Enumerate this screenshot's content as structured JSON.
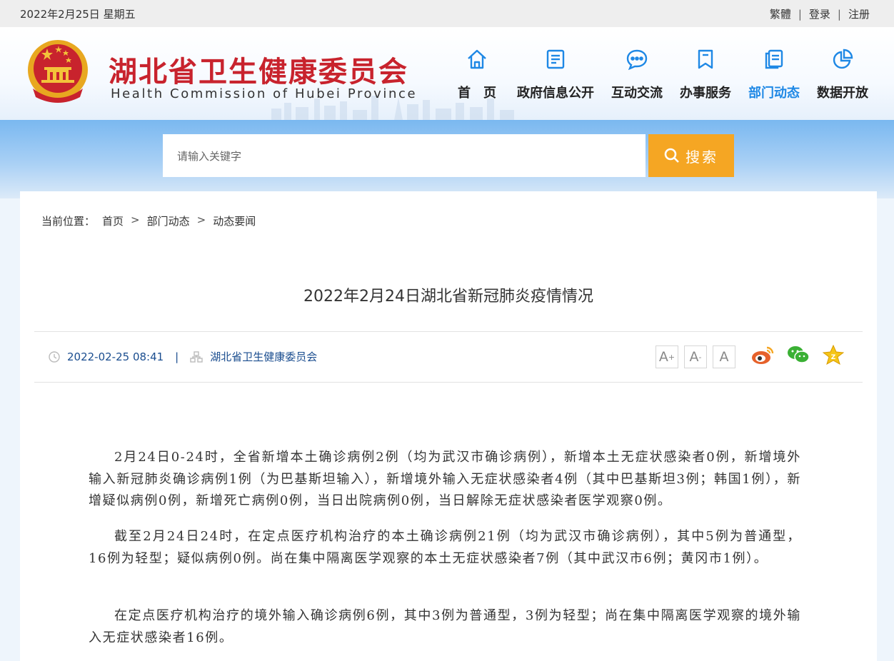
{
  "topbar": {
    "date": "2022年2月25日 星期五",
    "traditional": "繁體",
    "login": "登录",
    "register": "注册",
    "sep": "|"
  },
  "header": {
    "title": "湖北省卫生健康委员会",
    "subtitle": "Health Commission of Hubei Province"
  },
  "nav": [
    {
      "label": "首　页",
      "icon": "home-icon"
    },
    {
      "label": "政府信息公开",
      "icon": "document-icon"
    },
    {
      "label": "互动交流",
      "icon": "chat-bubble-icon"
    },
    {
      "label": "办事服务",
      "icon": "bookmark-icon"
    },
    {
      "label": "部门动态",
      "icon": "pages-icon",
      "active": true
    },
    {
      "label": "数据开放",
      "icon": "pie-chart-icon"
    }
  ],
  "search": {
    "placeholder": "请输入关键字",
    "button": "搜索"
  },
  "breadcrumb": {
    "prefix": "当前位置：",
    "items": [
      "首页",
      "部门动态",
      "动态要闻"
    ],
    "sep": ">"
  },
  "article": {
    "title": "2022年2月24日湖北省新冠肺炎疫情情况",
    "datetime": "2022-02-25 08:41",
    "meta_sep": "|",
    "source": "湖北省卫生健康委员会",
    "font_tools": [
      "A+",
      "A-",
      "A"
    ],
    "paragraphs": [
      "2月24日0-24时，全省新增本土确诊病例2例（均为武汉市确诊病例），新增本土无症状感染者0例，新增境外输入新冠肺炎确诊病例1例（为巴基斯坦输入），新增境外输入无症状感染者4例（其中巴基斯坦3例；韩国1例），新增疑似病例0例，新增死亡病例0例，当日出院病例0例，当日解除无症状感染者医学观察0例。",
      "截至2月24日24时，在定点医疗机构治疗的本土确诊病例21例（均为武汉市确诊病例），其中5例为普通型，16例为轻型；疑似病例0例。尚在集中隔离医学观察的本土无症状感染者7例（其中武汉市6例；黄冈市1例）。",
      "在定点医疗机构治疗的境外输入确诊病例6例，其中3例为普通型，3例为轻型；尚在集中隔离医学观察的境外输入无症状感染者16例。"
    ]
  },
  "share": [
    "weibo-icon",
    "wechat-icon",
    "favorite-star-icon"
  ],
  "colors": {
    "brand_red": "#c8232d",
    "nav_active": "#1e88e5",
    "search_button": "#f5a623"
  }
}
